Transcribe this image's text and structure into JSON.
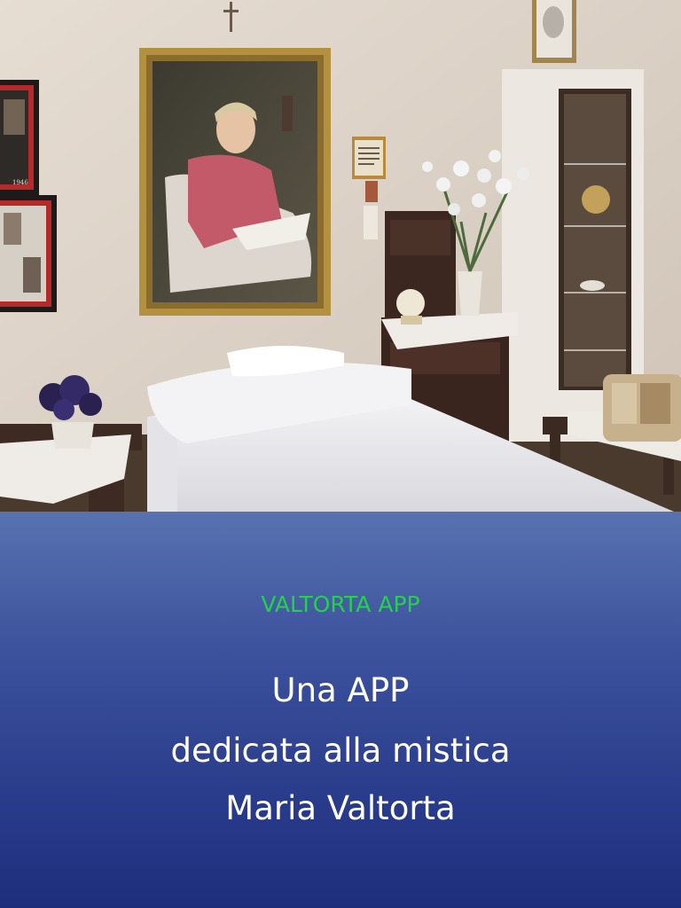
{
  "slide": {
    "eyebrow": "VALTORTA APP",
    "headline_lines": [
      "Una APP",
      "dedicata alla mistica",
      "Maria Valtorta"
    ]
  },
  "photo": {
    "frame_date": "1946"
  },
  "colors": {
    "eyebrow": "#22d24a",
    "headline": "#ffffff",
    "panel_top": "#5872b0",
    "panel_bottom": "#1d2e7c",
    "wall": "#d9cfc4"
  }
}
